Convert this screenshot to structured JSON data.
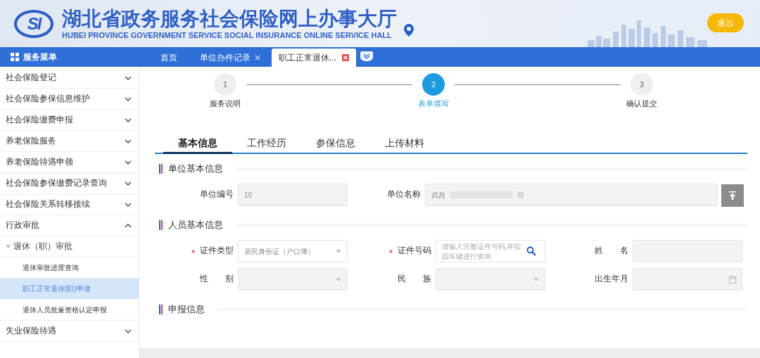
{
  "header": {
    "title": "湖北省政务服务社会保险网上办事大厅",
    "subtitle": "HUBEI PROVINCE GOVERNMENT SERVICE SOCIAL INSURANCE ONLINE SERVICE HALL",
    "logo_text": "SI",
    "exit_button": "退出"
  },
  "sidebar": {
    "title": "服务菜单",
    "items": [
      {
        "label": "社会保险登记",
        "expanded": false
      },
      {
        "label": "社会保险参保信息维护",
        "expanded": false
      },
      {
        "label": "社会保险缴费申报",
        "expanded": false
      },
      {
        "label": "养老保险服务",
        "expanded": false
      },
      {
        "label": "养老保险待遇申领",
        "expanded": false
      },
      {
        "label": "社会保险参保缴费记录查询",
        "expanded": false
      },
      {
        "label": "社会保险关系转移接续",
        "expanded": false
      },
      {
        "label": "行政审批",
        "expanded": true,
        "children": [
          {
            "label": "退休（职）审批",
            "expanded": true,
            "children": [
              {
                "label": "退休审批进度查询",
                "selected": false
              },
              {
                "label": "职工正常退休(职)申请",
                "selected": true
              },
              {
                "label": "退休人员批量资格认定申报",
                "selected": false
              }
            ]
          }
        ]
      },
      {
        "label": "失业保险待遇",
        "expanded": false
      }
    ]
  },
  "tabs": [
    {
      "label": "首页",
      "selected": false,
      "closable": false
    },
    {
      "label": "单位办件记录",
      "selected": false,
      "closable": true
    },
    {
      "label": "职工正常退休...",
      "selected": true,
      "closable": true
    }
  ],
  "steps": [
    {
      "number": "1",
      "label": "服务说明",
      "selected": false
    },
    {
      "number": "2",
      "label": "表单填写",
      "selected": true
    },
    {
      "number": "3",
      "label": "确认提交",
      "selected": false
    }
  ],
  "form_tabs": [
    {
      "label": "基本信息",
      "selected": true
    },
    {
      "label": "工作经历",
      "selected": false
    },
    {
      "label": "参保信息",
      "selected": false
    },
    {
      "label": "上传材料",
      "selected": false
    }
  ],
  "sections": [
    {
      "title": "单位基本信息",
      "fields": [
        {
          "label": "单位编号",
          "kind": "text",
          "value": "10",
          "wide": false
        },
        {
          "label": "单位名称",
          "kind": "text",
          "value": "武昌",
          "value_end": "司",
          "wide": true
        }
      ]
    },
    {
      "title": "人员基本信息",
      "fields": [
        {
          "label": "证件类型",
          "kind": "select",
          "required": true,
          "value": "居民身份证（户口簿）",
          "disabled": false
        },
        {
          "label": "证件号码",
          "kind": "search",
          "required": true,
          "placeholder": "请输入完整证件号码,并按回车键进行查询"
        },
        {
          "label": "姓　　名",
          "kind": "text"
        },
        {
          "label": "性　　别",
          "kind": "select",
          "disabled": true
        },
        {
          "label": "民　　族",
          "kind": "select",
          "disabled": true
        },
        {
          "label": "出生年月",
          "kind": "date"
        }
      ]
    },
    {
      "title": "申报信息"
    }
  ]
}
